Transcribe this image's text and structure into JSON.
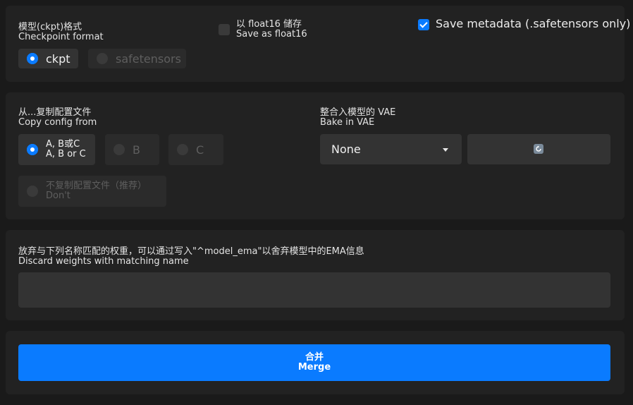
{
  "format": {
    "label_zh": "模型(ckpt)格式",
    "label_en": "Checkpoint format",
    "options": [
      "ckpt",
      "safetensors"
    ],
    "selected": "ckpt"
  },
  "float16": {
    "label_zh": "以 float16 储存",
    "label_en": "Save as float16",
    "checked": false
  },
  "metadata": {
    "label": "Save metadata (.safetensors only)",
    "checked": true
  },
  "config": {
    "label_zh": "从...复制配置文件",
    "label_en": "Copy config from",
    "option_abc_zh": "A, B或C",
    "option_abc_en": "A, B or C",
    "option_b": "B",
    "option_c": "C",
    "option_none_zh": "不复制配置文件（推荐）",
    "option_none_en": "Don't"
  },
  "vae": {
    "label_zh": "整合入模型的 VAE",
    "label_en": "Bake in VAE",
    "selected": "None",
    "refresh_icon": "refresh-icon"
  },
  "discard": {
    "label_zh": "放弃与下列名称匹配的权重，可以通过写入\"^model_ema\"以舍弃模型中的EMA信息",
    "label_en": "Discard weights with matching name",
    "value": ""
  },
  "merge": {
    "label_zh": "合并",
    "label_en": "Merge"
  },
  "colors": {
    "accent": "#0a7bff",
    "panel": "#222222",
    "background": "#1a1a1a"
  }
}
